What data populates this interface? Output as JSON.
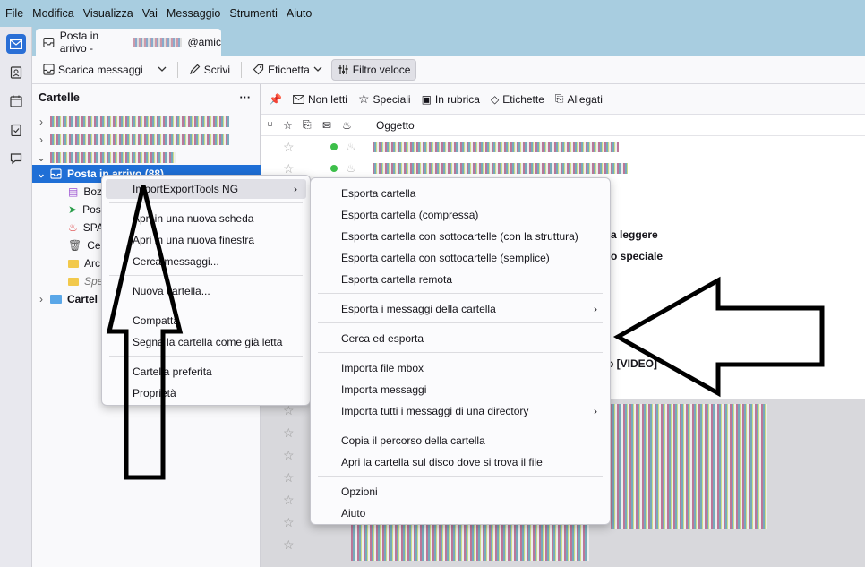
{
  "menubar": [
    "File",
    "Modifica",
    "Visualizza",
    "Vai",
    "Messaggio",
    "Strumenti",
    "Aiuto"
  ],
  "tab": {
    "title": "Posta in arrivo - ",
    "title_tail": "@amic"
  },
  "toolbar": {
    "get_messages": "Scarica messaggi",
    "write": "Scrivi",
    "tag": "Etichetta",
    "quick_filter": "Filtro veloce"
  },
  "folderpane": {
    "header": "Cartelle",
    "more": "···",
    "inbox": "Posta in arrivo (88)",
    "folders": [
      "Boz",
      "Pos",
      "SPA",
      "Ces",
      "Arc",
      "Spe",
      "Cartel"
    ]
  },
  "quickfilter": [
    "Non letti",
    "Speciali",
    "In rubrica",
    "Etichette",
    "Allegati"
  ],
  "thead": {
    "subject": "Oggetto"
  },
  "visible_fragments": [
    "a leggere",
    "o speciale",
    "o [VIDEO]"
  ],
  "menu1": {
    "items": [
      {
        "label": "ImportExportTools NG",
        "submenu": true
      },
      {
        "label": "Apri in una nuova scheda"
      },
      {
        "label": "Apri in una nuova finestra"
      },
      {
        "label": "Cerca messaggi..."
      },
      {
        "label": "Nuova cartella..."
      },
      {
        "label": "Compatta"
      },
      {
        "label": "Segna la cartella come già letta"
      },
      {
        "label": "Cartella preferita"
      },
      {
        "label": "Proprietà"
      }
    ]
  },
  "menu2": {
    "items": [
      {
        "label": "Esporta cartella"
      },
      {
        "label": "Esporta cartella (compressa)"
      },
      {
        "label": "Esporta cartella con sottocartelle (con la struttura)"
      },
      {
        "label": "Esporta cartella con sottocartelle (semplice)"
      },
      {
        "label": "Esporta cartella remota"
      },
      {
        "label": "Esporta i messaggi della cartella",
        "submenu": true
      },
      {
        "label": "Cerca ed esporta"
      },
      {
        "label": "Importa file mbox"
      },
      {
        "label": "Importa messaggi"
      },
      {
        "label": "Importa tutti i messaggi di una directory",
        "submenu": true
      },
      {
        "label": "Copia il percorso della cartella"
      },
      {
        "label": "Apri la cartella sul disco dove si trova il file"
      },
      {
        "label": "Opzioni"
      },
      {
        "label": "Aiuto"
      }
    ]
  },
  "submenu_arrow": "›"
}
